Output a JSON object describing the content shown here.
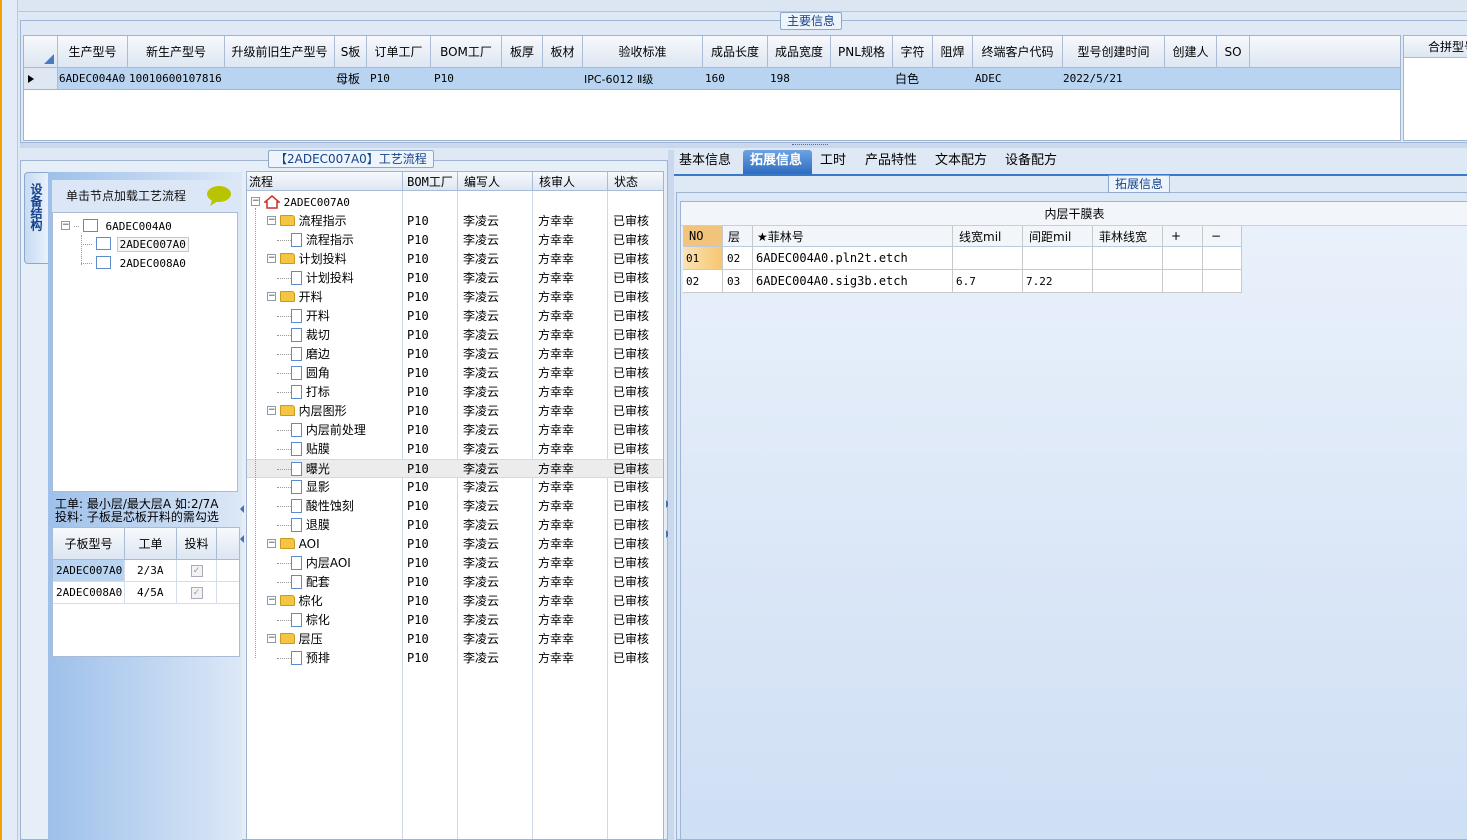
{
  "main_group": {
    "title": "主要信息"
  },
  "main_grid": {
    "columns": [
      "生产型号",
      "新生产型号",
      "升级前旧生产型号",
      "S板",
      "订单工厂",
      "BOM工厂",
      "板厚",
      "板材",
      "验收标准",
      "成品长度",
      "成品宽度",
      "PNL规格",
      "字符",
      "阻焊",
      "终端客户代码",
      "型号创建时间",
      "创建人",
      "SO"
    ],
    "rows": [
      [
        "6ADEC004A0",
        "10010600107816",
        "",
        "母板",
        "P10",
        "P10",
        "",
        "",
        "IPC-6012 Ⅱ级",
        "160",
        "198",
        "",
        "白色",
        "",
        "ADEC",
        "2022/5/21",
        "",
        ""
      ]
    ]
  },
  "merge_group": {
    "title": "合拼型号"
  },
  "process_group": {
    "title": "【2ADEC007A0】工艺流程"
  },
  "side_tab": {
    "label": "设备结构"
  },
  "left_tree": {
    "hint": "单击节点加载工艺流程",
    "nodes": [
      {
        "label": "6ADEC004A0"
      },
      {
        "label": "2ADEC007A0"
      },
      {
        "label": "2ADEC008A0"
      }
    ]
  },
  "notes": {
    "line1": "工单: 最小层/最大层A 如:2/7A",
    "line2": "投料: 子板是芯板开料的需勾选"
  },
  "sub_grid": {
    "columns": [
      "子板型号",
      "工单",
      "投料"
    ],
    "rows": [
      {
        "model": "2ADEC007A0",
        "order": "2/3A",
        "feed": true
      },
      {
        "model": "2ADEC008A0",
        "order": "4/5A",
        "feed": true
      }
    ]
  },
  "flow": {
    "columns": [
      "流程",
      "BOM工厂",
      "编写人",
      "核审人",
      "状态"
    ],
    "root": "2ADEC007A0",
    "rows": [
      {
        "name": "流程指示",
        "kind": "folder",
        "bom": "P10",
        "writer": "李凌云",
        "reviewer": "方幸幸",
        "status": "已审核"
      },
      {
        "name": "流程指示",
        "kind": "doc",
        "bom": "P10",
        "writer": "李凌云",
        "reviewer": "方幸幸",
        "status": "已审核"
      },
      {
        "name": "计划投料",
        "kind": "folder",
        "bom": "P10",
        "writer": "李凌云",
        "reviewer": "方幸幸",
        "status": "已审核"
      },
      {
        "name": "计划投料",
        "kind": "doc",
        "bom": "P10",
        "writer": "李凌云",
        "reviewer": "方幸幸",
        "status": "已审核"
      },
      {
        "name": "开料",
        "kind": "folder",
        "bom": "P10",
        "writer": "李凌云",
        "reviewer": "方幸幸",
        "status": "已审核"
      },
      {
        "name": "开料",
        "kind": "doc",
        "bom": "P10",
        "writer": "李凌云",
        "reviewer": "方幸幸",
        "status": "已审核"
      },
      {
        "name": "裁切",
        "kind": "doc",
        "bom": "P10",
        "writer": "李凌云",
        "reviewer": "方幸幸",
        "status": "已审核"
      },
      {
        "name": "磨边",
        "kind": "doc",
        "bom": "P10",
        "writer": "李凌云",
        "reviewer": "方幸幸",
        "status": "已审核"
      },
      {
        "name": "圆角",
        "kind": "doc",
        "bom": "P10",
        "writer": "李凌云",
        "reviewer": "方幸幸",
        "status": "已审核"
      },
      {
        "name": "打标",
        "kind": "doc",
        "bom": "P10",
        "writer": "李凌云",
        "reviewer": "方幸幸",
        "status": "已审核"
      },
      {
        "name": "内层图形",
        "kind": "folder",
        "bom": "P10",
        "writer": "李凌云",
        "reviewer": "方幸幸",
        "status": "已审核"
      },
      {
        "name": "内层前处理",
        "kind": "doc",
        "bom": "P10",
        "writer": "李凌云",
        "reviewer": "方幸幸",
        "status": "已审核"
      },
      {
        "name": "贴膜",
        "kind": "doc",
        "bom": "P10",
        "writer": "李凌云",
        "reviewer": "方幸幸",
        "status": "已审核"
      },
      {
        "name": "曝光",
        "kind": "doc",
        "bom": "P10",
        "writer": "李凌云",
        "reviewer": "方幸幸",
        "status": "已审核",
        "selected": true
      },
      {
        "name": "显影",
        "kind": "doc",
        "bom": "P10",
        "writer": "李凌云",
        "reviewer": "方幸幸",
        "status": "已审核"
      },
      {
        "name": "酸性蚀刻",
        "kind": "doc",
        "bom": "P10",
        "writer": "李凌云",
        "reviewer": "方幸幸",
        "status": "已审核"
      },
      {
        "name": "退膜",
        "kind": "doc",
        "bom": "P10",
        "writer": "李凌云",
        "reviewer": "方幸幸",
        "status": "已审核"
      },
      {
        "name": "AOI",
        "kind": "folder",
        "bom": "P10",
        "writer": "李凌云",
        "reviewer": "方幸幸",
        "status": "已审核"
      },
      {
        "name": "内层AOI",
        "kind": "doc",
        "bom": "P10",
        "writer": "李凌云",
        "reviewer": "方幸幸",
        "status": "已审核"
      },
      {
        "name": "配套",
        "kind": "doc",
        "bom": "P10",
        "writer": "李凌云",
        "reviewer": "方幸幸",
        "status": "已审核"
      },
      {
        "name": "棕化",
        "kind": "folder",
        "bom": "P10",
        "writer": "李凌云",
        "reviewer": "方幸幸",
        "status": "已审核"
      },
      {
        "name": "棕化",
        "kind": "doc",
        "bom": "P10",
        "writer": "李凌云",
        "reviewer": "方幸幸",
        "status": "已审核"
      },
      {
        "name": "层压",
        "kind": "folder",
        "bom": "P10",
        "writer": "李凌云",
        "reviewer": "方幸幸",
        "status": "已审核"
      },
      {
        "name": "预排",
        "kind": "doc",
        "bom": "P10",
        "writer": "李凌云",
        "reviewer": "方幸幸",
        "status": "已审核"
      }
    ]
  },
  "tabs": [
    "基本信息",
    "拓展信息",
    "工时",
    "产品特性",
    "文本配方",
    "设备配方"
  ],
  "active_tab": "拓展信息",
  "ext_group": {
    "title": "拓展信息"
  },
  "film_table": {
    "title": "内层干膜表",
    "columns": [
      "NO",
      "层",
      "★菲林号",
      "线宽mil",
      "间距mil",
      "菲林线宽",
      "+",
      "−"
    ],
    "rows": [
      [
        "01",
        "02",
        "6ADEC004A0.pln2t.etch",
        "",
        "",
        "",
        "",
        ""
      ],
      [
        "02",
        "03",
        "6ADEC004A0.sig3b.etch",
        "6.7",
        "7.22",
        "",
        "",
        ""
      ]
    ]
  },
  "colors": {
    "accent": "#15428b",
    "selected_row": "#b9d4f1",
    "active_tab": "#3a78c9",
    "bg": "#dfe9f5"
  }
}
